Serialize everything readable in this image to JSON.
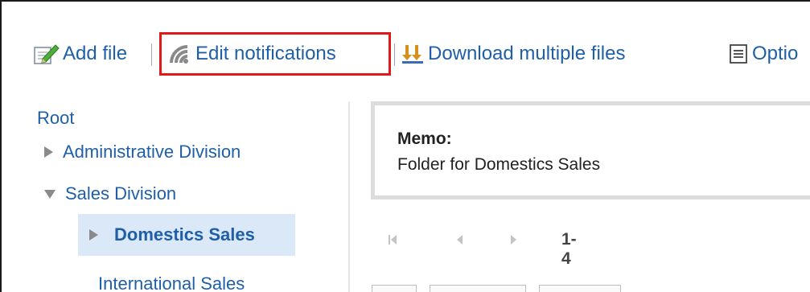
{
  "toolbar": {
    "add_file": "Add file",
    "edit_notifications": "Edit notifications",
    "download_multiple": "Download multiple files",
    "options": "Optio"
  },
  "tree": {
    "root": "Root",
    "items": [
      {
        "label": "Administrative Division",
        "state": "collapsed"
      },
      {
        "label": "Sales Division",
        "state": "expanded"
      },
      {
        "label": "Domestics Sales",
        "state": "collapsed",
        "selected": true
      },
      {
        "label": "International Sales",
        "state": "leaf"
      }
    ]
  },
  "memo": {
    "label": "Memo:",
    "text": "Folder for Domestics Sales"
  },
  "pagination": {
    "range": "1-4"
  },
  "colors": {
    "link": "#1f5fa8",
    "highlight_border": "#e01a1a",
    "selected_bg": "#dbe8f7"
  }
}
